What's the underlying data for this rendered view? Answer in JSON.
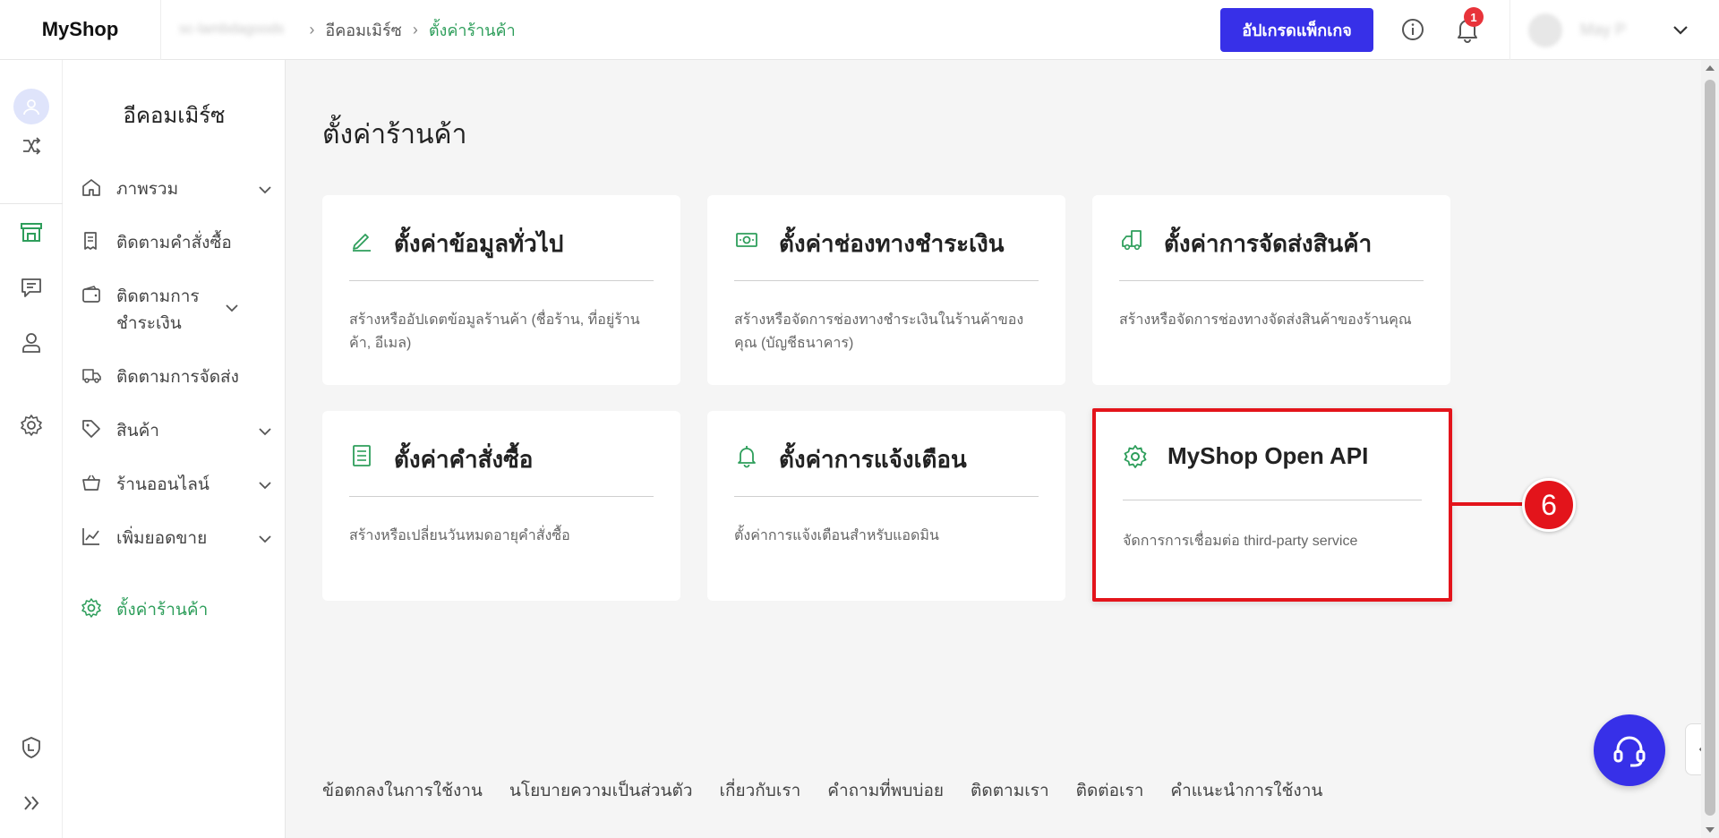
{
  "app": {
    "logo": "MyShop"
  },
  "breadcrumb": {
    "shop": "sc-lambdagoods",
    "section": "อีคอมเมิร์ซ",
    "current": "ตั้งค่าร้านค้า"
  },
  "header": {
    "upgrade_label": "อัปเกรดแพ็กเกจ",
    "notification_count": "1",
    "user_name": "May P"
  },
  "sidebar": {
    "title": "อีคอมเมิร์ซ",
    "items": [
      {
        "label": "ภาพรวม",
        "icon": "home-icon",
        "has_children": true
      },
      {
        "label": "ติดตามคำสั่งซื้อ",
        "icon": "receipt-icon",
        "has_children": false
      },
      {
        "label": "ติดตามการ ชำระเงิน",
        "icon": "wallet-icon",
        "has_children": true
      },
      {
        "label": "ติดตามการจัดส่ง",
        "icon": "truck-icon",
        "has_children": false
      },
      {
        "label": "สินค้า",
        "icon": "tag-icon",
        "has_children": true
      },
      {
        "label": "ร้านออนไลน์",
        "icon": "basket-icon",
        "has_children": true
      },
      {
        "label": "เพิ่มยอดขาย",
        "icon": "chart-icon",
        "has_children": true
      },
      {
        "label": "ตั้งค่าร้านค้า",
        "icon": "gear-icon",
        "has_children": false,
        "active": true
      }
    ]
  },
  "main": {
    "title": "ตั้งค่าร้านค้า",
    "cards": [
      {
        "title": "ตั้งค่าข้อมูลทั่วไป",
        "desc": "สร้างหรืออัปเดตข้อมูลร้านค้า (ชื่อร้าน, ที่อยู่ร้านค้า, อีเมล)",
        "icon": "pencil-icon"
      },
      {
        "title": "ตั้งค่าช่องทางชำระเงิน",
        "desc": "สร้างหรือจัดการช่องทางชำระเงินในร้านค้าของคุณ (บัญชีธนาคาร)",
        "icon": "cash-icon"
      },
      {
        "title": "ตั้งค่าการจัดส่งสินค้า",
        "desc": "สร้างหรือจัดการช่องทางจัดส่งสินค้าของร้านคุณ",
        "icon": "truck-icon"
      },
      {
        "title": "ตั้งค่าคำสั่งซื้อ",
        "desc": "สร้างหรือเปลี่ยนวันหมดอายุคำสั่งซื้อ",
        "icon": "list-icon"
      },
      {
        "title": "ตั้งค่าการแจ้งเตือน",
        "desc": "ตั้งค่าการแจ้งเตือนสำหรับแอดมิน",
        "icon": "bell-icon"
      },
      {
        "title": "MyShop Open API",
        "desc": "จัดการการเชื่อมต่อ third-party service",
        "icon": "gear-icon",
        "highlighted": true
      }
    ]
  },
  "callout": {
    "number": "6"
  },
  "footer": {
    "links": [
      "ข้อตกลงในการใช้งาน",
      "นโยบายความเป็นส่วนตัว",
      "เกี่ยวกับเรา",
      "คำถามที่พบบ่อย",
      "ติดตามเรา",
      "ติดต่อเรา",
      "คำแนะนำการใช้งาน"
    ]
  },
  "colors": {
    "brand": "#3730e8",
    "active": "#2e9e5b",
    "highlight": "#e3141b"
  }
}
